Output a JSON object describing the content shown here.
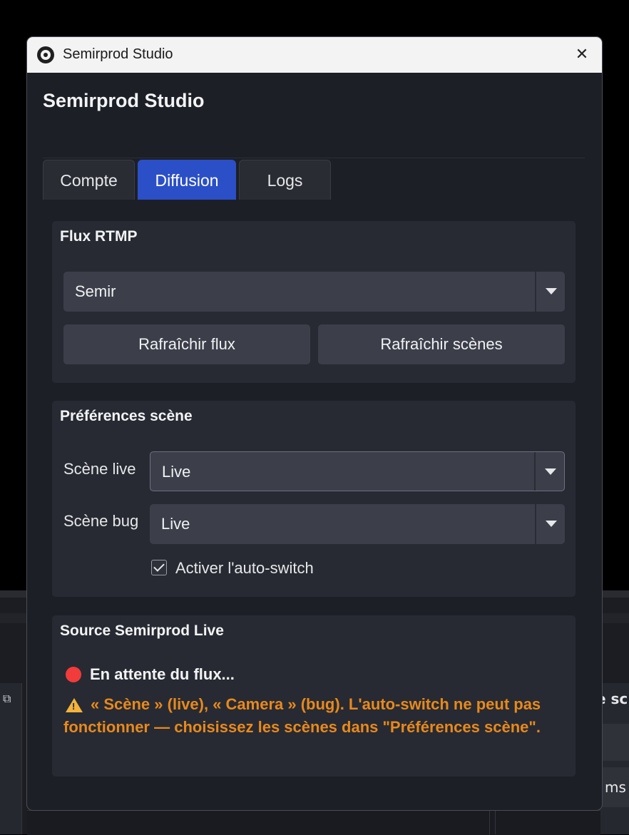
{
  "window": {
    "title": "Semirprod Studio",
    "close_icon": "close-icon"
  },
  "header": {
    "title": "Semirprod Studio"
  },
  "tabs": [
    {
      "label": "Compte",
      "active": false
    },
    {
      "label": "Diffusion",
      "active": true
    },
    {
      "label": "Logs",
      "active": false
    }
  ],
  "flux_rtmp": {
    "title": "Flux RTMP",
    "stream_select": "Semir",
    "refresh_flux_label": "Rafraîchir flux",
    "refresh_scenes_label": "Rafraîchir scènes"
  },
  "scene_prefs": {
    "title": "Préférences scène",
    "live_label": "Scène live",
    "live_value": "Live",
    "bug_label": "Scène bug",
    "bug_value": "Live",
    "auto_switch_label": "Activer l'auto-switch",
    "auto_switch_checked": true
  },
  "source": {
    "title": "Source Semirprod Live",
    "status": "En attente du flux...",
    "status_color": "#f23b3b",
    "warning": "« Scène » (live), « Camera » (bug). L'auto-switch ne peut pas fonctionner — choisissez les scènes dans \"Préférences scène\".",
    "warning_color": "#e8891c"
  },
  "background_app": {
    "right_panel_title": "e sc",
    "right_panel_value": "ms"
  },
  "colors": {
    "accent": "#2b4fc7",
    "panel_bg": "#1d1f26",
    "group_bg": "#272a32"
  }
}
